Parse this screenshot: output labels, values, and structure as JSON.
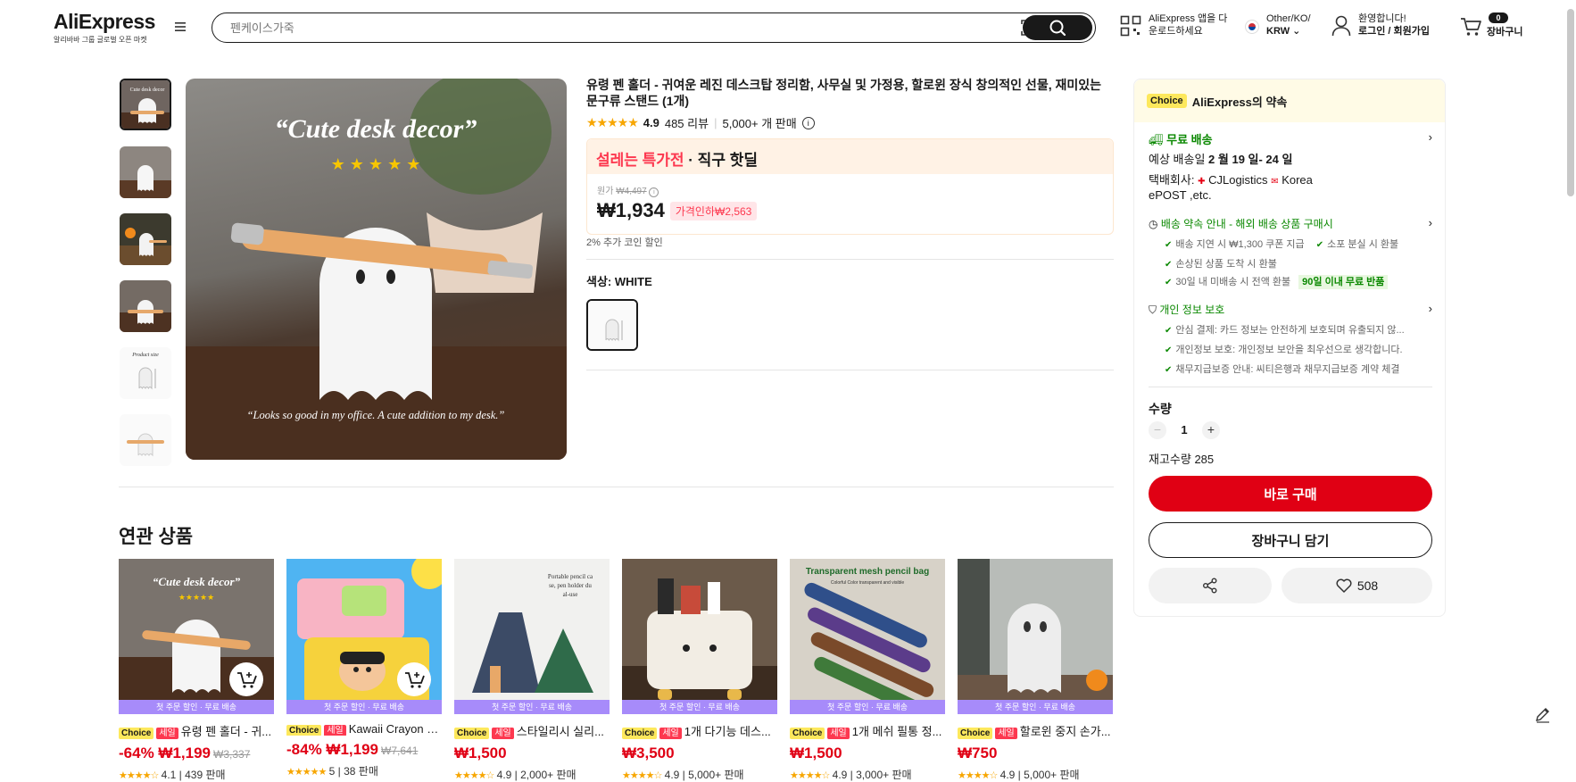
{
  "header": {
    "logo": "AliExpress",
    "logo_sub": "알리바바 그룹 글로벌 오픈 마켓",
    "search_placeholder": "펜케이스가죽",
    "app_line1": "AliExpress 앱을 다",
    "app_line2": "운로드하세요",
    "region_line1": "Other/KO/",
    "region_line2": "KRW",
    "account_line1": "환영합니다!",
    "account_line2": "로그인 / 회원가입",
    "cart_count": "0",
    "cart_label": "장바구니"
  },
  "gallery": {
    "main_caption_title": "“Cute desk decor”",
    "main_caption_quote": "“Looks so good in my office. A cute addition to my desk.”",
    "thumb_label": "Product size"
  },
  "product": {
    "title": "유령 펜 홀더 - 귀여운 레진 데스크탑 정리함, 사무실 및 가정용, 할로윈 장식 창의적인 선물, 재미있는 문구류 스탠드 (1개)",
    "rating": "4.9",
    "reviews": "485 리뷰",
    "sold": "5,000+ 개 판매",
    "promo_red": "설레는 특가전",
    "promo_rest": " · 직구 핫딜",
    "original_label": "원가",
    "original_price": "₩4,497",
    "price": "₩1,934",
    "discount_tag": "가격인하₩2,563",
    "coin_discount": "2% 추가 코인 할인",
    "color_label": "색상: WHITE"
  },
  "panel": {
    "choice": "Choice",
    "promise": "AliExpress의 약속",
    "shipping_title": "무료 배송",
    "delivery_prefix": "예상 배송일",
    "delivery_date": "2 월 19 일- 24 일",
    "carrier_line1": "택배회사:",
    "carrier_name1": "CJLogistics",
    "carrier_name2": "Korea",
    "carrier_line2": "ePOST ,etc.",
    "guarantee_title": "배송 약속 안내 - 해외 배송 상품 구매시",
    "g1": "배송 지연 시 ₩1,300 쿠폰 지급",
    "g2": "소포 분실 시 환불",
    "g3": "손상된 상품 도착 시 환불",
    "g4": "30일 내 미배송 시 전액 환불",
    "g4_badge": "90일 이내 무료 반품",
    "privacy_title": "개인 정보 보호",
    "p1": "안심 결제: 카드 정보는 안전하게 보호되며 유출되지 않...",
    "p2": "개인정보 보호: 개인정보 보안을 최우선으로 생각합니다.",
    "p3": "채무지급보증 안내: 씨티은행과 채무지급보증 계약 체결",
    "qty_label": "수량",
    "qty": "1",
    "stock": "재고수량 285",
    "buy_now": "바로 구매",
    "add_cart": "장바구니 담기",
    "wishlist_count": "508"
  },
  "related": {
    "title": "연관 상품",
    "strip": "첫 주문 할인 · 무료 배송",
    "choice_tag": "Choice",
    "sale_tag": "세일",
    "items": [
      {
        "name": "유령 펜 홀더 - 귀...",
        "discount": "-64%",
        "price": "₩1,199",
        "orig": "₩3,337",
        "meta": "4.1 | 439 판매"
      },
      {
        "name": "Kawaii Crayon S...",
        "discount": "-84%",
        "price": "₩1,199",
        "orig": "₩7,641",
        "meta": "5 | 38 판매"
      },
      {
        "name": "스타일리시 실리...",
        "discount": "",
        "price": "₩1,500",
        "orig": "",
        "meta": "4.9 | 2,000+ 판매"
      },
      {
        "name": "1개 다기능 데스...",
        "discount": "",
        "price": "₩3,500",
        "orig": "",
        "meta": "4.9 | 5,000+ 판매"
      },
      {
        "name": "1개 메쉬 필통 정...",
        "discount": "",
        "price": "₩1,500",
        "orig": "",
        "meta": "4.9 | 3,000+ 판매"
      },
      {
        "name": "할로윈 중지 손가...",
        "discount": "",
        "price": "₩750",
        "orig": "",
        "meta": "4.9 | 5,000+ 판매"
      }
    ]
  }
}
